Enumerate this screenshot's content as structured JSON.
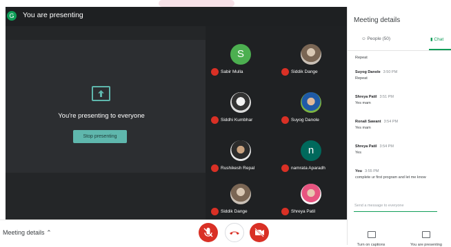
{
  "window": {
    "avatar_letter": "G",
    "title": "You are presenting"
  },
  "presentation": {
    "message": "You're presenting to everyone",
    "stop_button": "Stop presenting"
  },
  "participants": [
    {
      "name": "Sabir Mulla",
      "avatar_letter": "S",
      "color": "#4caf50"
    },
    {
      "name": "Siddik Dange",
      "avatar_letter": "",
      "color": ""
    },
    {
      "name": "Siddhi Kumbhar",
      "avatar_letter": "",
      "color": ""
    },
    {
      "name": "Suyog Danole",
      "avatar_letter": "",
      "color": ""
    },
    {
      "name": "Rushikesh Repal",
      "avatar_letter": "",
      "color": ""
    },
    {
      "name": "namrata Aparadh",
      "avatar_letter": "n",
      "color": "#00695c"
    },
    {
      "name": "Siddik Dange",
      "avatar_letter": "",
      "color": ""
    },
    {
      "name": "Shreya Patil",
      "avatar_letter": "",
      "color": ""
    }
  ],
  "sidebar": {
    "title": "Meeting details",
    "tabs": [
      {
        "label": "People (50)"
      },
      {
        "label": "Chat"
      }
    ],
    "messages": [
      {
        "sender": "",
        "time": "",
        "text": "Repeat"
      },
      {
        "sender": "Suyog Danole",
        "time": "3:50 PM",
        "text": "Repeat"
      },
      {
        "sender": "Shreya Patil",
        "time": "3:51 PM",
        "text": "Yes mam"
      },
      {
        "sender": "Ronali Sawant",
        "time": "3:54 PM",
        "text": "Yes mam"
      },
      {
        "sender": "Shreya Patil",
        "time": "3:54 PM",
        "text": "Yes"
      },
      {
        "sender": "You",
        "time": "3:55 PM",
        "text": "complete ur first program and let me know"
      }
    ],
    "input_placeholder": "Send a message to everyone"
  },
  "bottombar": {
    "meeting_details": "Meeting details",
    "captions_label": "Turn on captions",
    "presenting_label": "You are presenting"
  },
  "colors": {
    "accent": "#5fb7ad",
    "danger": "#d93025",
    "chat_green": "#0f9d58"
  }
}
